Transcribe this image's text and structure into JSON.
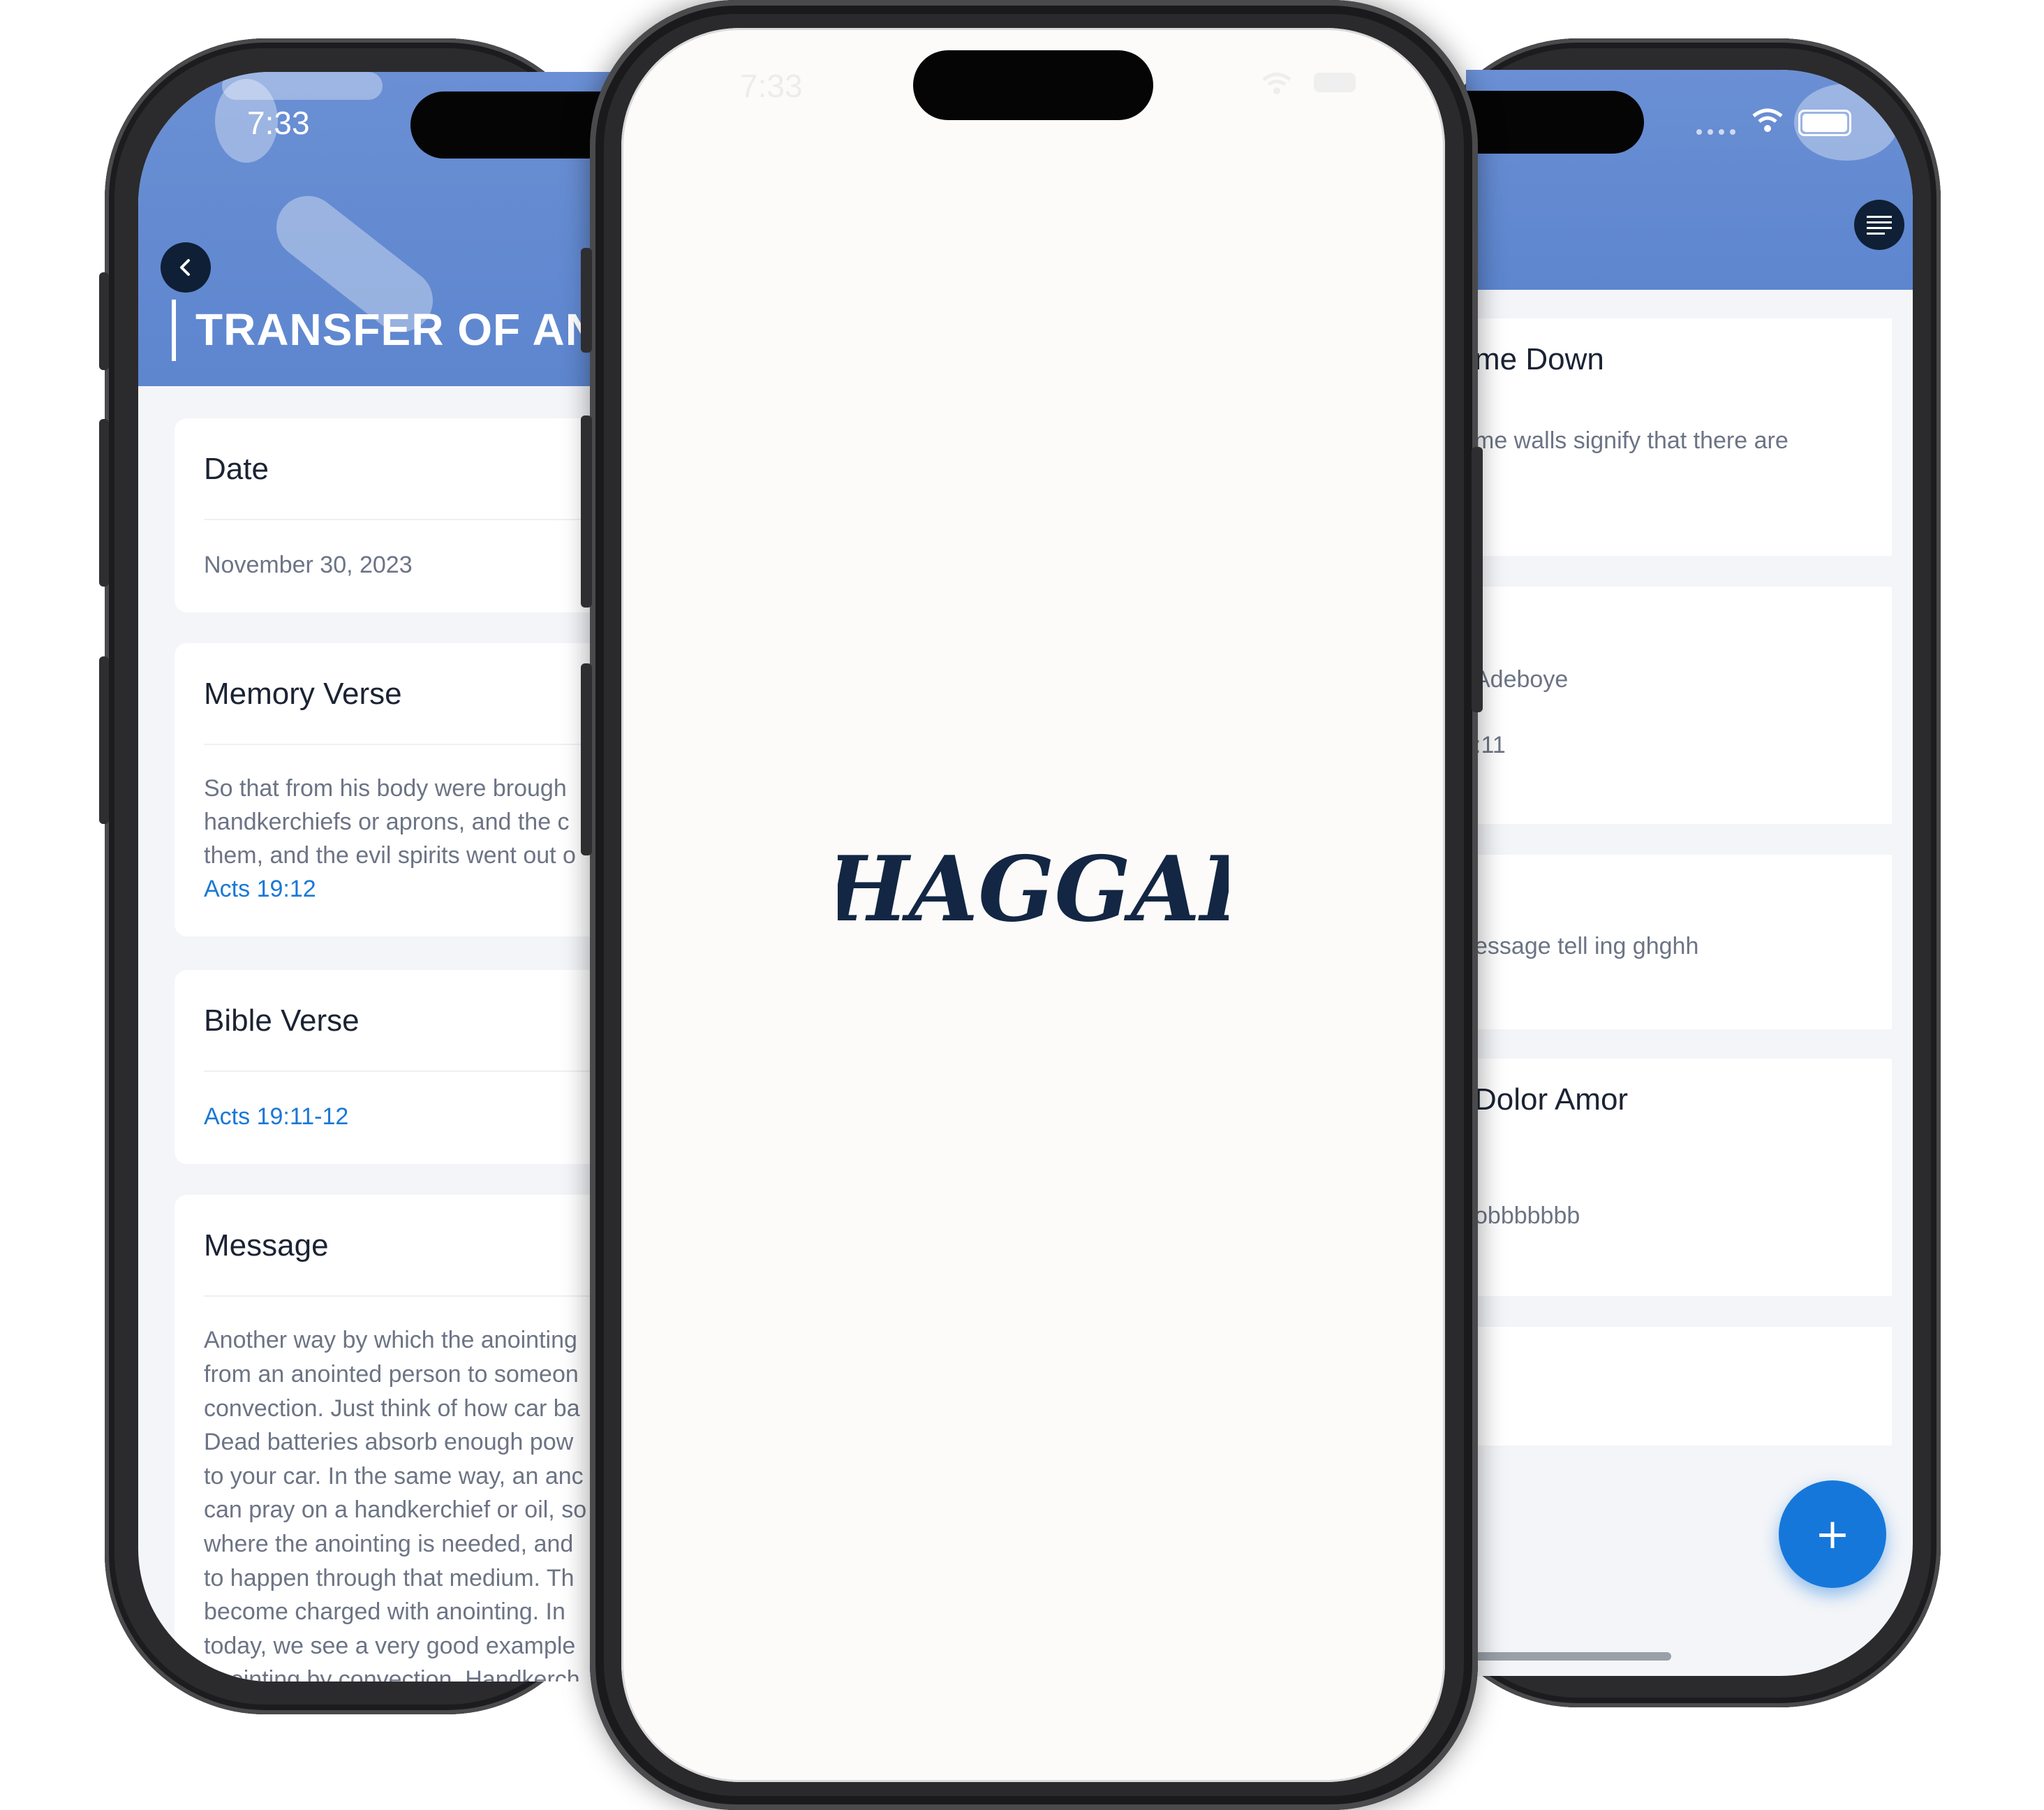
{
  "left_screen": {
    "status_time": "7:33",
    "title": "TRANSFER OF ANC",
    "cards": [
      {
        "heading": "Date",
        "body": [
          "November 30, 2023"
        ],
        "link": ""
      },
      {
        "heading": "Memory Verse",
        "body": [
          "So that from his body were brough",
          "handkerchiefs or aprons, and the c",
          "them, and the evil spirits went out o"
        ],
        "link": "Acts 19:12"
      },
      {
        "heading": "Bible Verse",
        "body": [],
        "link": "Acts 19:11-12"
      },
      {
        "heading": "Message",
        "body": [
          "Another way by which the anointing",
          "from an anointed person to someon",
          "convection. Just think of how car ba",
          "Dead batteries absorb enough pow",
          "to your car. In the same way, an anc",
          "can pray on a handkerchief or oil, so",
          "where the anointing is needed, and",
          "to happen through that medium. Th",
          "become charged with anointing. In",
          "today, we see a very good example",
          "anointing by convection. Handkerch"
        ],
        "link": ""
      }
    ]
  },
  "center_screen": {
    "status_time": "7:33",
    "logo_text": "HAGGAI"
  },
  "right_screen": {
    "items": [
      {
        "title": "me Down",
        "lines": [
          "me walls signify that there are"
        ]
      },
      {
        "title": "",
        "lines": [
          "Adeboye",
          ":11"
        ]
      },
      {
        "title": "",
        "lines": [
          "essage tell ing ghghh"
        ]
      },
      {
        "title": "Dolor Amor",
        "lines": [
          "obbbbbbb"
        ]
      },
      {
        "title": "",
        "lines": []
      }
    ],
    "fab_label": "+"
  },
  "colors": {
    "hero_blue": "#5d86cf",
    "navy": "#0f1f35",
    "link_blue": "#1a78d6",
    "fab_blue": "#1677db",
    "logo_navy": "#132744"
  }
}
